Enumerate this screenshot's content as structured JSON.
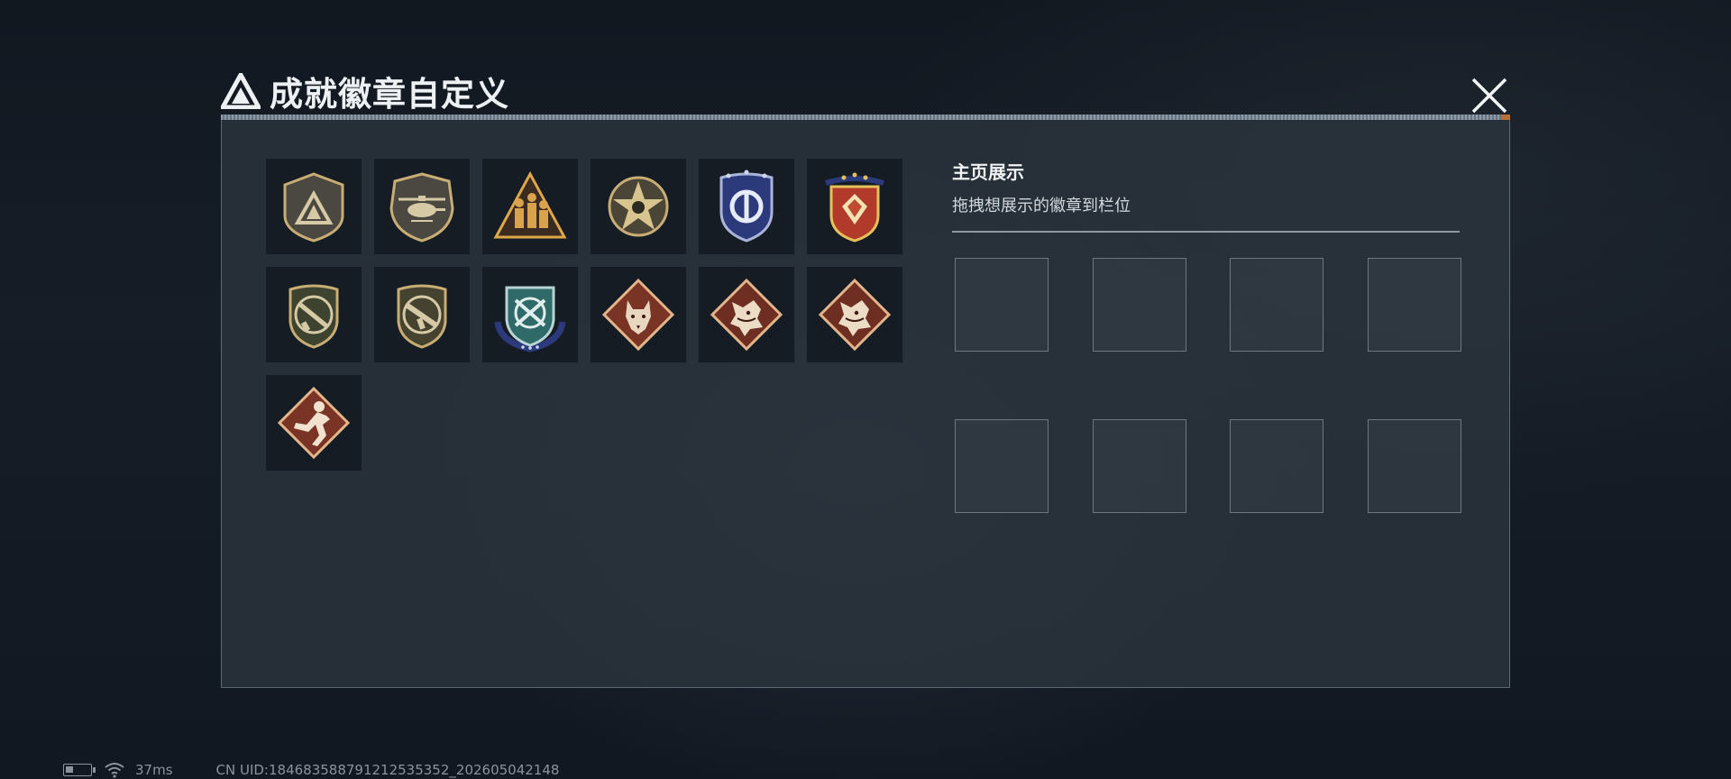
{
  "header": {
    "title": "成就徽章自定义",
    "close_icon": "close-icon",
    "logo_icon": "triangle-logo-icon"
  },
  "badges": [
    {
      "name": "triangle-shield-badge",
      "icon": "triangle-shield"
    },
    {
      "name": "helicopter-shield-badge",
      "icon": "helicopter-shield"
    },
    {
      "name": "soldiers-triangle-badge",
      "icon": "soldiers-triangle"
    },
    {
      "name": "star-seal-badge",
      "icon": "star-seal"
    },
    {
      "name": "blue-shield-badge",
      "icon": "blue-shield"
    },
    {
      "name": "red-gold-shield-badge",
      "icon": "red-gold-shield"
    },
    {
      "name": "rifle-shield-badge",
      "icon": "rifle-shield"
    },
    {
      "name": "smg-shield-badge",
      "icon": "smg-shield"
    },
    {
      "name": "teal-crossed-badge",
      "icon": "teal-crossed-shield"
    },
    {
      "name": "wolf-diamond-badge",
      "icon": "wolf-diamond"
    },
    {
      "name": "dragon-diamond-badge-1",
      "icon": "dragon-diamond"
    },
    {
      "name": "dragon-diamond-badge-2",
      "icon": "dragon-diamond"
    },
    {
      "name": "runner-diamond-badge",
      "icon": "runner-diamond"
    }
  ],
  "showcase": {
    "title": "主页展示",
    "subtitle": "拖拽想展示的徽章到栏位",
    "slot_count": 8
  },
  "status": {
    "ping": "37ms",
    "uid": "CN UID:184683588791212535352_202605042148"
  },
  "colors": {
    "accent_orange": "#c77a3a",
    "gold": "#c8ad74",
    "red_brown": "#7a3426",
    "navy": "#2c3a7c"
  }
}
